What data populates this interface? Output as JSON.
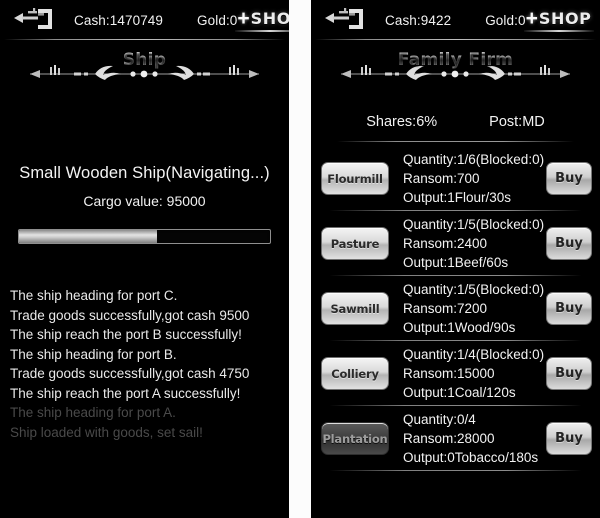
{
  "left_panel": {
    "topbar": {
      "icon": "ship-anchor-icon",
      "cash_label": "Cash:1470749",
      "gold_label": "Gold:0",
      "shop_plus": "+",
      "shop_label": "SHOP"
    },
    "title": "Ship",
    "ship": {
      "name": "Small Wooden Ship(Navigating...)",
      "cargo_value": "Cargo value: 95000",
      "progress_percent": 55
    },
    "log": [
      {
        "text": "The ship heading for port C.",
        "faded": false
      },
      {
        "text": "Trade goods successfully,got cash 9500",
        "faded": false
      },
      {
        "text": "The ship reach the port B successfully!",
        "faded": false
      },
      {
        "text": "The ship heading for port B.",
        "faded": false
      },
      {
        "text": "Trade goods successfully,got cash 4750",
        "faded": false
      },
      {
        "text": "The ship reach the port A successfully!",
        "faded": false
      },
      {
        "text": "The ship heading for port A.",
        "faded": true
      },
      {
        "text": "Ship loaded with goods, set sail!",
        "faded": true
      }
    ]
  },
  "right_panel": {
    "topbar": {
      "icon": "ship-anchor-icon",
      "cash_label": "Cash:9422",
      "gold_label": "Gold:0",
      "shop_plus": "+",
      "shop_label": "SHOP"
    },
    "title": "Family Firm",
    "shares_label": "Shares:6%",
    "post_label": "Post:MD",
    "buy_label": "Buy",
    "firms": [
      {
        "name": "Flourmill",
        "quantity": "Quantity:1/6(Blocked:0)",
        "ransom": "Ransom:700",
        "output": "Output:1Flour/30s",
        "dim": false
      },
      {
        "name": "Pasture",
        "quantity": "Quantity:1/5(Blocked:0)",
        "ransom": "Ransom:2400",
        "output": "Output:1Beef/60s",
        "dim": false
      },
      {
        "name": "Sawmill",
        "quantity": "Quantity:1/5(Blocked:0)",
        "ransom": "Ransom:7200",
        "output": "Output:1Wood/90s",
        "dim": false
      },
      {
        "name": "Colliery",
        "quantity": "Quantity:1/4(Blocked:0)",
        "ransom": "Ransom:15000",
        "output": "Output:1Coal/120s",
        "dim": false
      },
      {
        "name": "Plantation",
        "quantity": "Quantity:0/4",
        "ransom": "Ransom:28000",
        "output": "Output:0Tobacco/180s",
        "dim": true
      }
    ]
  },
  "colors": {
    "background": "#000000",
    "text": "#f2f2f2",
    "faded_text": "#4a4a4a",
    "separator": "#ffffff"
  }
}
